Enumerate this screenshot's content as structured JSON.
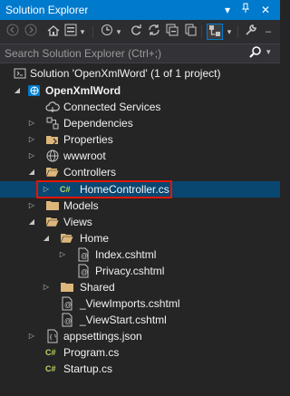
{
  "window": {
    "title": "Solution Explorer"
  },
  "search": {
    "placeholder": "Search Solution Explorer (Ctrl+;)"
  },
  "colors": {
    "accent": "#007acc",
    "selection": "#094771",
    "highlight_border": "#e51400",
    "folder": "#dcb67a",
    "csharp": "#68217a"
  },
  "tree": {
    "solution": "Solution 'OpenXmlWord' (1 of 1 project)",
    "project": "OpenXmlWord",
    "connected_services": "Connected Services",
    "dependencies": "Dependencies",
    "properties": "Properties",
    "wwwroot": "wwwroot",
    "controllers": "Controllers",
    "home_controller": "HomeController.cs",
    "models": "Models",
    "views": "Views",
    "home": "Home",
    "index": "Index.cshtml",
    "privacy": "Privacy.cshtml",
    "shared": "Shared",
    "view_imports": "_ViewImports.cshtml",
    "view_start": "_ViewStart.cshtml",
    "appsettings": "appsettings.json",
    "program": "Program.cs",
    "startup": "Startup.cs"
  },
  "icons": {
    "cs_badge": "C#"
  }
}
